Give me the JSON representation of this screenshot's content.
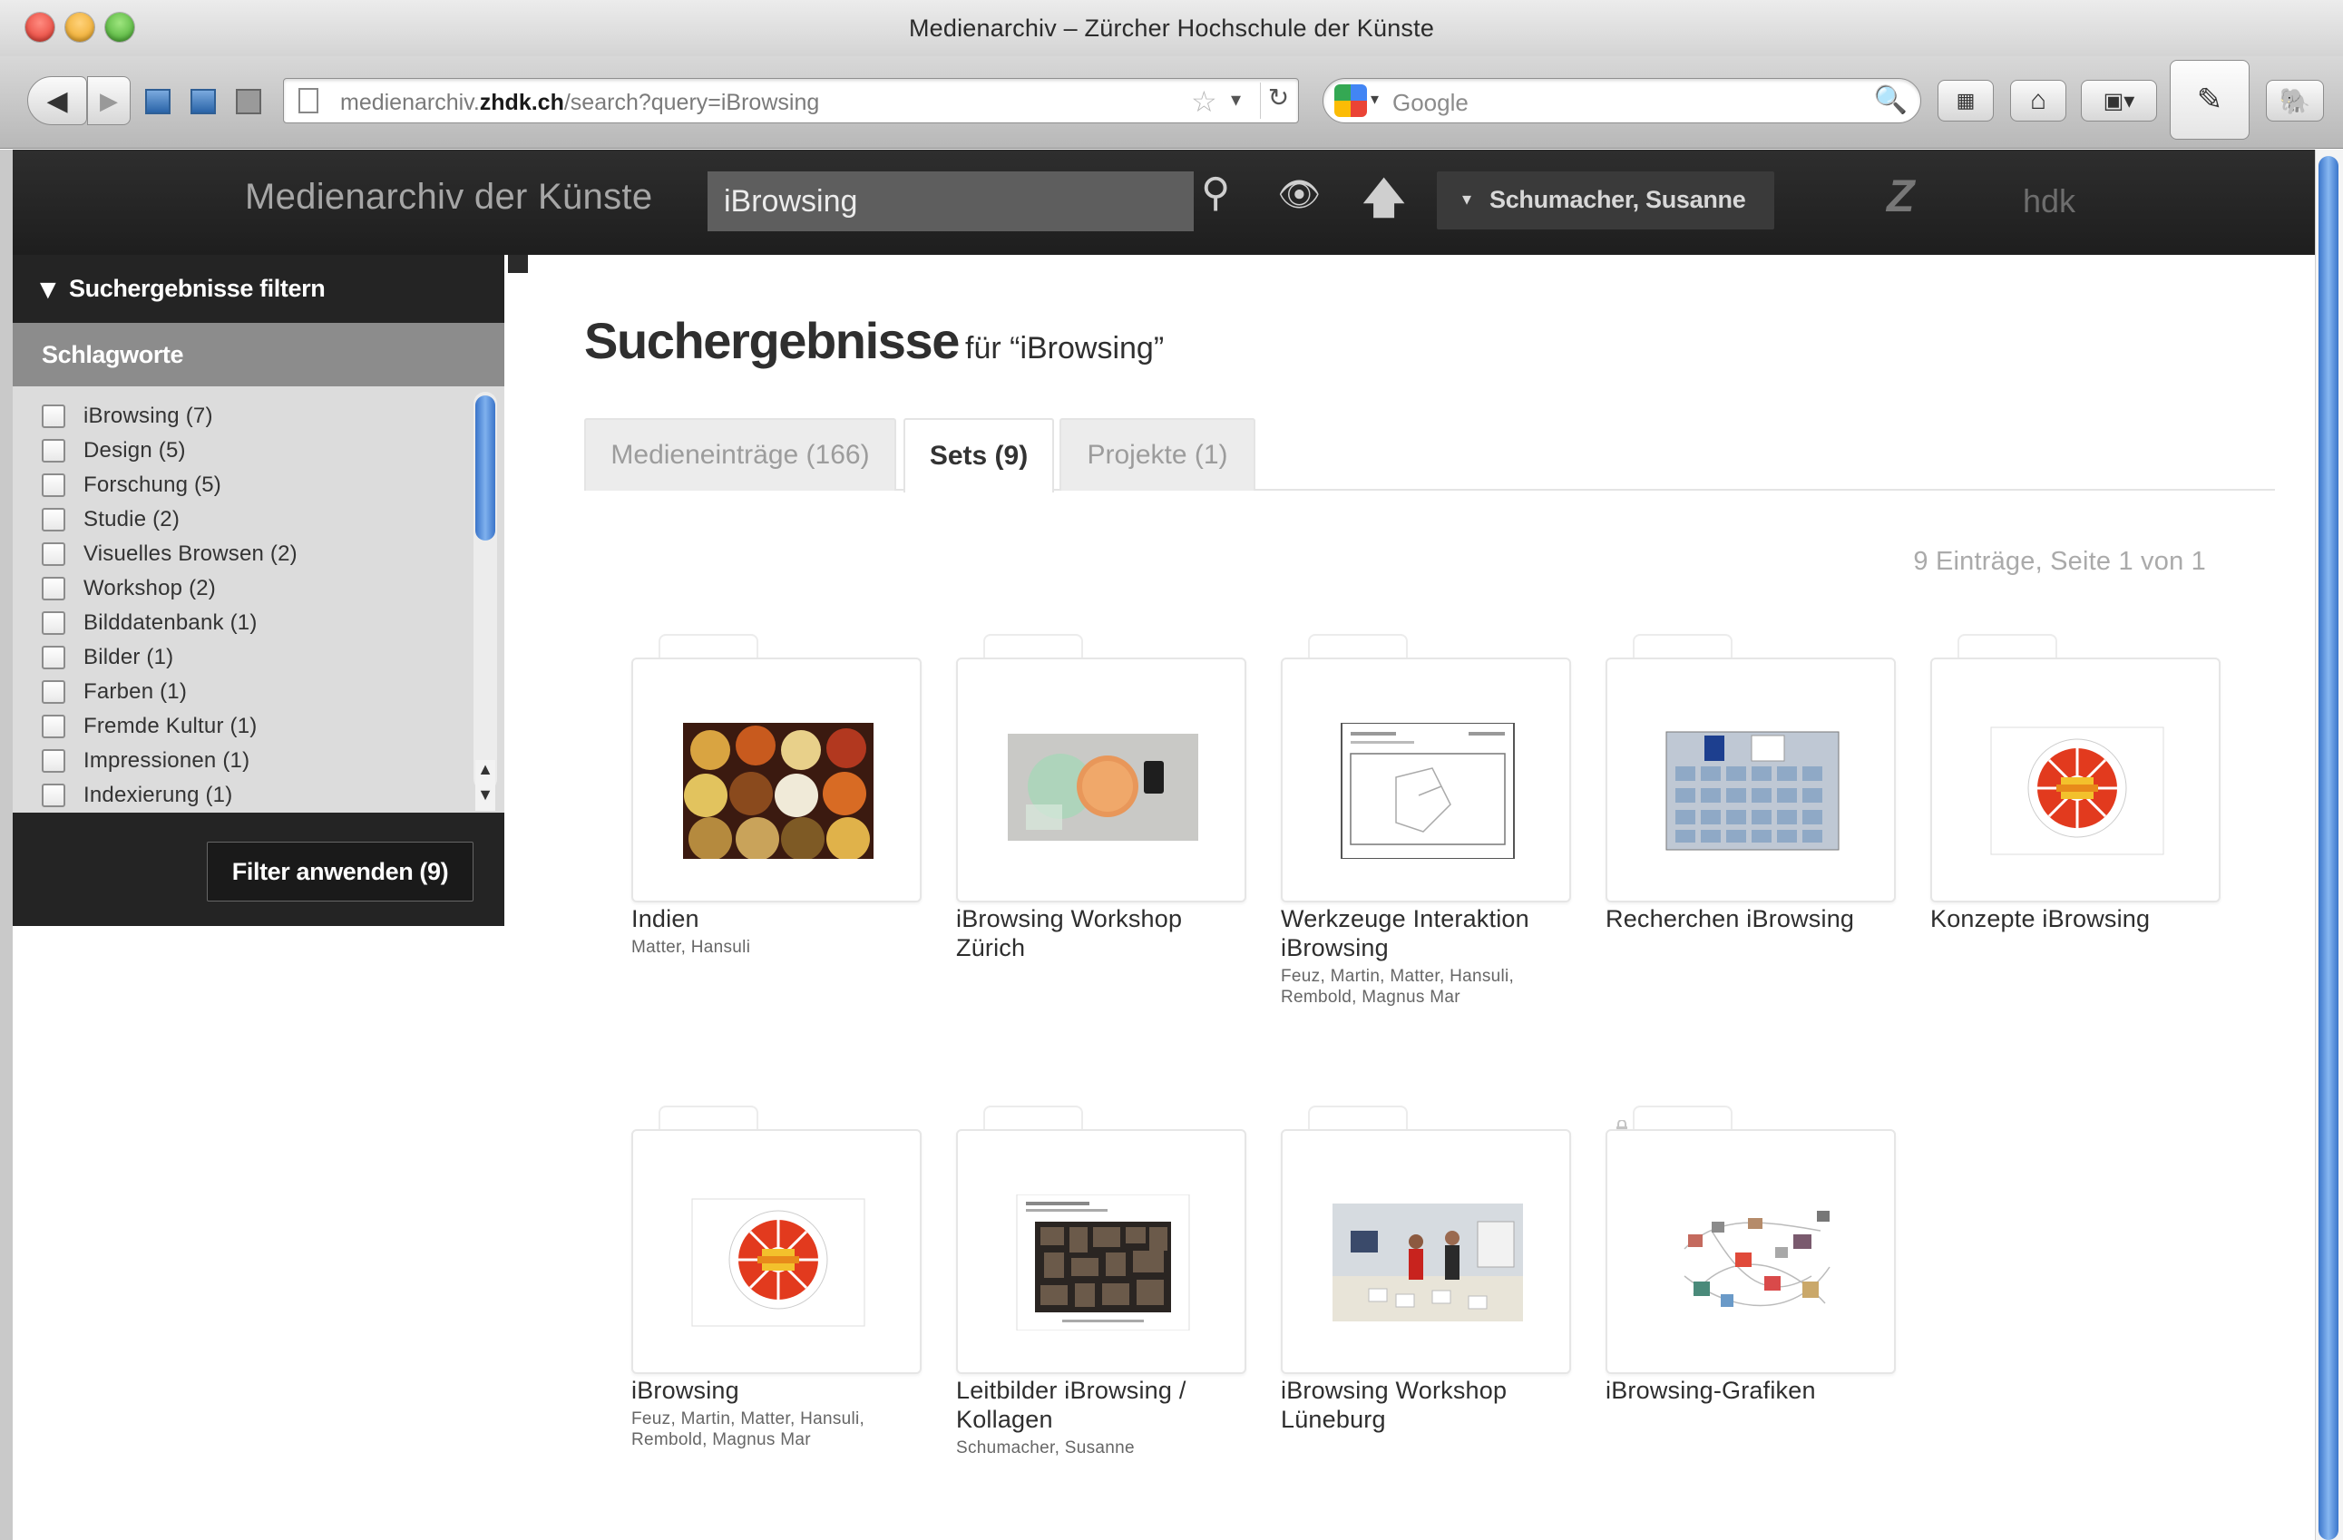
{
  "window": {
    "title": "Medienarchiv – Zürcher Hochschule der Künste"
  },
  "browser": {
    "url_prefix": "medienarchiv.",
    "url_domain": "zhdk.ch",
    "url_path": "/search?query=iBrowsing",
    "search_engine": "Google",
    "icons": {
      "back": "◀",
      "forward": "▶",
      "star": "☆",
      "dropdown": "▾",
      "reload": "↻",
      "search": "🔍",
      "bookmarks": "▦",
      "home": "⌂",
      "addon": "▣▾",
      "pencil": "✎",
      "evernote": "🐘"
    }
  },
  "header": {
    "app_title": "Medienarchiv der Künste",
    "search_value": "iBrowsing",
    "user_name": "Schumacher, Susanne",
    "logo_z": "Z",
    "logo_hdk": "hdk",
    "icons": {
      "search": "⚲",
      "eye": "👁",
      "upload": "🡅",
      "caret": "▾"
    }
  },
  "sidebar": {
    "filter_title": "Suchergebnisse filtern",
    "keywords_title": "Schlagworte",
    "keywords": [
      "iBrowsing (7)",
      "Design (5)",
      "Forschung (5)",
      "Studie (2)",
      "Visuelles Browsen (2)",
      "Workshop (2)",
      "Bilddatenbank (1)",
      "Bilder (1)",
      "Farben (1)",
      "Fremde Kultur (1)",
      "Impressionen (1)",
      "Indexierung (1)"
    ],
    "apply_label": "Filter anwenden (9)",
    "icons": {
      "filter": "▼",
      "up": "▲",
      "down": "▼"
    }
  },
  "main": {
    "title": "Suchergebnisse",
    "subtitle": "für “iBrowsing”",
    "tabs": [
      {
        "label": "Medieneinträge (166)",
        "active": false
      },
      {
        "label": "Sets (9)",
        "active": true
      },
      {
        "label": "Projekte (1)",
        "active": false
      }
    ],
    "results_count": "9 Einträge, Seite 1 von 1",
    "sets": [
      {
        "title": "Indien",
        "owner": "Matter, Hansuli",
        "thumb": "spices-photo"
      },
      {
        "title": "iBrowsing Workshop Zürich",
        "owner": "",
        "thumb": "workshop-objects-photo"
      },
      {
        "title": "Werkzeuge Interaktion iBrowsing",
        "owner": "Feuz, Martin, Matter, Hansuli, Rembold, Magnus Mar",
        "thumb": "sketch-document"
      },
      {
        "title": "Recherchen iBrowsing",
        "owner": "",
        "thumb": "research-collage"
      },
      {
        "title": "Konzepte iBrowsing",
        "owner": "",
        "thumb": "concept-wheel"
      },
      {
        "title": "iBrowsing",
        "owner": "Feuz, Martin, Matter, Hansuli, Rembold, Magnus Mar",
        "thumb": "concept-wheel"
      },
      {
        "title": "Leitbilder iBrowsing / Kollagen",
        "owner": "Schumacher, Susanne",
        "thumb": "collage-board"
      },
      {
        "title": "iBrowsing Workshop Lüneburg",
        "owner": "",
        "thumb": "workshop-room-photo"
      },
      {
        "title": "iBrowsing-Grafiken",
        "owner": "",
        "thumb": "graph-network",
        "locked": true
      }
    ]
  }
}
